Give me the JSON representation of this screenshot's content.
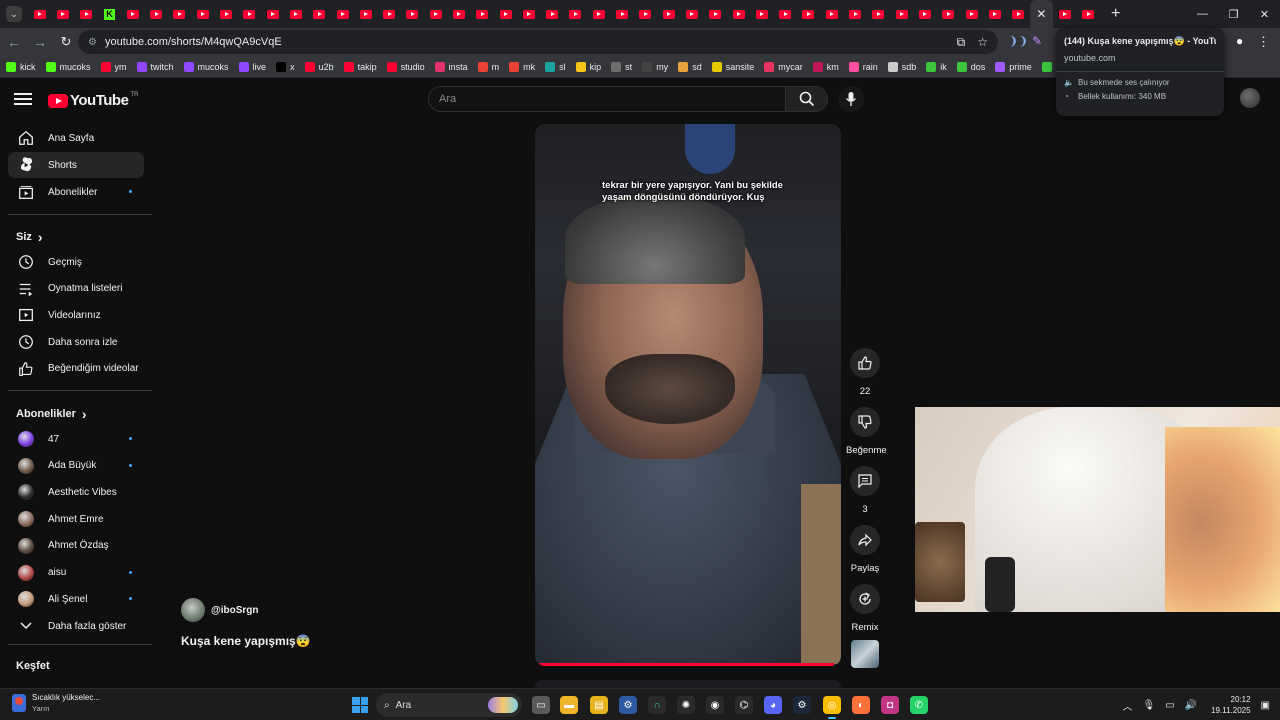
{
  "browser": {
    "tab_count_youtube": 44,
    "new_tab_label": "+",
    "url": "youtube.com/shorts/M4qwQA9cVqE",
    "bookmarks": [
      {
        "label": "kick",
        "color": "#53fc18"
      },
      {
        "label": "mucoks",
        "color": "#53fc18"
      },
      {
        "label": "ym",
        "color": "#ff0033"
      },
      {
        "label": "twitch",
        "color": "#9146ff"
      },
      {
        "label": "mucoks",
        "color": "#9146ff"
      },
      {
        "label": "live",
        "color": "#9146ff"
      },
      {
        "label": "x",
        "color": "#000000"
      },
      {
        "label": "u2b",
        "color": "#ff0033"
      },
      {
        "label": "takip",
        "color": "#ff0033"
      },
      {
        "label": "studio",
        "color": "#ff0033"
      },
      {
        "label": "insta",
        "color": "#e1306c"
      },
      {
        "label": "m",
        "color": "#ea4335"
      },
      {
        "label": "mk",
        "color": "#ea4335"
      },
      {
        "label": "sl",
        "color": "#1da1a1"
      },
      {
        "label": "kip",
        "color": "#f5c518"
      },
      {
        "label": "st",
        "color": "#6f6f6f"
      },
      {
        "label": "my",
        "color": "#444444"
      },
      {
        "label": "sd",
        "color": "#e8a33c"
      },
      {
        "label": "sansite",
        "color": "#e7c900"
      },
      {
        "label": "mycar",
        "color": "#e6335f"
      },
      {
        "label": "km",
        "color": "#c2185b"
      },
      {
        "label": "rain",
        "color": "#ff4fa0"
      },
      {
        "label": "sdb",
        "color": "#cccccc"
      },
      {
        "label": "ik",
        "color": "#3cc43c"
      },
      {
        "label": "dos",
        "color": "#3cc43c"
      },
      {
        "label": "prime",
        "color": "#9b59ff"
      },
      {
        "label": "lo",
        "color": "#3cc43c"
      }
    ],
    "hover_card": {
      "title": "(144) Kuşa kene yapışmış😨 - YouTube",
      "url": "youtube.com",
      "audio_label": "Bu sekmede ses çalınıyor",
      "memory_label": "Bellek kullanımı: 340 MB"
    }
  },
  "youtube": {
    "logo_text": "YouTube",
    "logo_region": "TR",
    "search_placeholder": "Ara",
    "sidebar": {
      "main": [
        {
          "label": "Ana Sayfa",
          "icon": "home-icon"
        },
        {
          "label": "Shorts",
          "icon": "shorts-icon",
          "active": true
        },
        {
          "label": "Abonelikler",
          "icon": "subscriptions-icon",
          "dot": true
        }
      ],
      "you_header": "Siz",
      "you": [
        {
          "label": "Geçmiş",
          "icon": "history-icon"
        },
        {
          "label": "Oynatma listeleri",
          "icon": "playlists-icon"
        },
        {
          "label": "Videolarınız",
          "icon": "your-videos-icon"
        },
        {
          "label": "Daha sonra izle",
          "icon": "watch-later-icon"
        },
        {
          "label": "Beğendiğim videolar",
          "icon": "liked-videos-icon"
        }
      ],
      "subs_header": "Abonelikler",
      "subscriptions": [
        {
          "label": "47",
          "dot": true,
          "color": "#7b3fe4"
        },
        {
          "label": "Ada Büyük",
          "dot": true,
          "color": "#6e5a4b"
        },
        {
          "label": "Aesthetic Vibes",
          "dot": false,
          "color": "#2b2b2b"
        },
        {
          "label": "Ahmet Emre",
          "dot": false,
          "color": "#8a6b5c"
        },
        {
          "label": "Ahmet Özdaş",
          "dot": false,
          "color": "#5a4a3f"
        },
        {
          "label": "aisu",
          "dot": true,
          "color": "#b24848"
        },
        {
          "label": "Ali Şenel",
          "dot": true,
          "color": "#c49a7a"
        }
      ],
      "show_more": "Daha fazla göster",
      "explore_header": "Keşfet"
    },
    "short": {
      "caption": "tekrar bir yere yapışıyor. Yani bu şekilde yaşam döngüsünü döndürüyor. Kuş",
      "channel": "@iboSrgn",
      "title": "Kuşa kene yapışmış😨",
      "progress": 0.99
    },
    "actions": {
      "like_count": "22",
      "dislike_label": "Beğenme",
      "comment_count": "3",
      "share_label": "Paylaş",
      "remix_label": "Remix"
    }
  },
  "taskbar": {
    "weather_title": "Sıcaklık yükselec...",
    "weather_sub": "Yarın",
    "search_label": "Ara",
    "time": "20:12",
    "date": "19.11.2025"
  }
}
